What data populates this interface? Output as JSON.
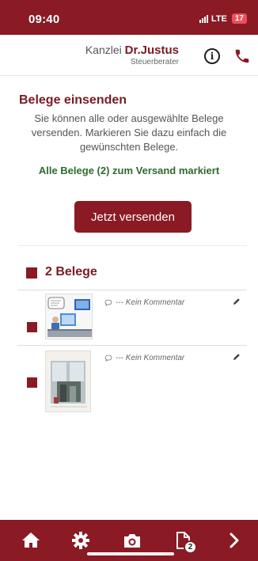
{
  "status_bar": {
    "time": "09:40",
    "network": "LTE",
    "battery": "17"
  },
  "header": {
    "brand_prefix": "Kanzlei",
    "brand_name": "Dr.Justus",
    "brand_subtitle": "Steuerberater",
    "info_icon": "info-icon",
    "phone_icon": "phone-icon"
  },
  "main": {
    "title": "Belege einsenden",
    "intro": "Sie können alle oder ausgewählte Belege versenden. Markieren Sie dazu einfach die gewünschten Belege.",
    "marked_status": "Alle Belege (2) zum Versand markiert",
    "send_button": "Jetzt versenden",
    "group_title": "2 Belege",
    "documents": [
      {
        "comment": "--- Kein Kommentar",
        "thumbnail": "cartoon-receipt",
        "checked": true
      },
      {
        "comment": "--- Kein Kommentar",
        "thumbnail": "photo-receipt",
        "checked": true
      }
    ]
  },
  "bottom_nav": {
    "items": [
      "home-icon",
      "gear-icon",
      "camera-icon",
      "document-icon",
      "chevron-right-icon"
    ],
    "documents_badge": "2"
  },
  "colors": {
    "brand": "#8a1a24",
    "title": "#7a1a25",
    "success": "#2e6b2e"
  }
}
